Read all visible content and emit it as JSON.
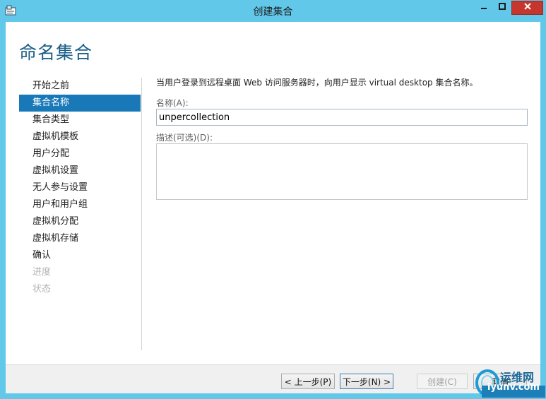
{
  "window": {
    "title": "创建集合",
    "icons": {
      "app": "wizard-app-icon",
      "minimize": "minimize-icon",
      "maximize": "maximize-icon",
      "close": "close-icon"
    },
    "colors": {
      "frame": "#62c8ea",
      "close": "#c7362d",
      "accent": "#1979b8",
      "heading": "#1a5e86"
    }
  },
  "page": {
    "title": "命名集合"
  },
  "nav": {
    "items": [
      {
        "label": "开始之前",
        "state": "normal"
      },
      {
        "label": "集合名称",
        "state": "active"
      },
      {
        "label": "集合类型",
        "state": "normal"
      },
      {
        "label": "虚拟机模板",
        "state": "normal"
      },
      {
        "label": "用户分配",
        "state": "normal"
      },
      {
        "label": "虚拟机设置",
        "state": "normal"
      },
      {
        "label": "无人参与设置",
        "state": "normal"
      },
      {
        "label": "用户和用户组",
        "state": "normal"
      },
      {
        "label": "虚拟机分配",
        "state": "normal"
      },
      {
        "label": "虚拟机存储",
        "state": "normal"
      },
      {
        "label": "确认",
        "state": "normal"
      },
      {
        "label": "进度",
        "state": "disabled"
      },
      {
        "label": "状态",
        "state": "disabled"
      }
    ]
  },
  "content": {
    "intro": "当用户登录到远程桌面 Web 访问服务器时，向用户显示 virtual desktop 集合名称。",
    "name_label": "名称(A):",
    "name_value": "unpercollection",
    "description_label": "描述(可选)(D):",
    "description_value": ""
  },
  "footer": {
    "prev": "< 上一步(P)",
    "next": "下一步(N) >",
    "create": "创建(C)",
    "cancel": "取消"
  },
  "watermark": {
    "line1": "运维网",
    "line2": "iyunv.com"
  }
}
